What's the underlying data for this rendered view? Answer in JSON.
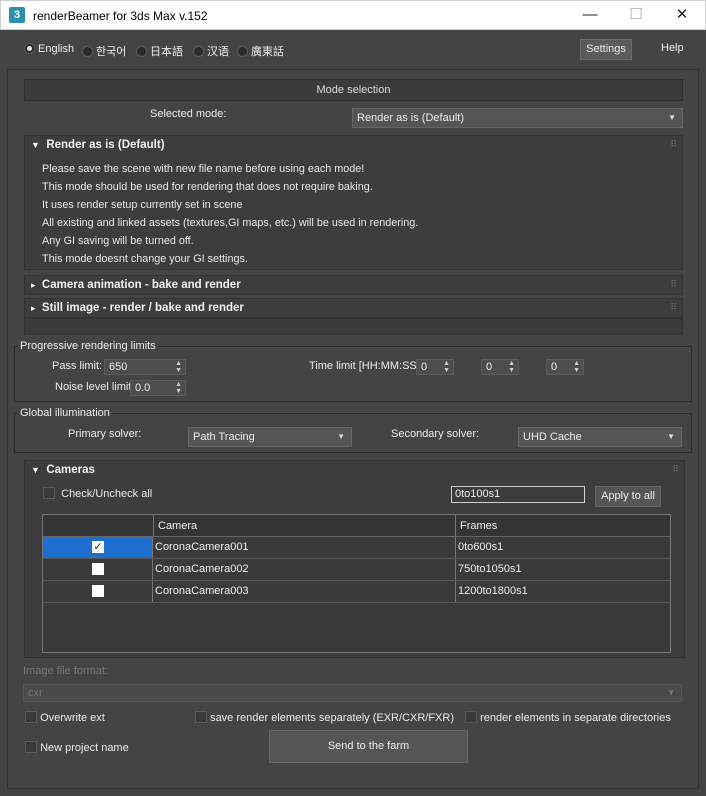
{
  "window": {
    "icon_text": "3",
    "title": "renderBeamer for 3ds Max v.152",
    "minimize": "—",
    "maximize": "☐",
    "close": "✕"
  },
  "languages": [
    {
      "label": "English",
      "selected": true
    },
    {
      "label": "한국어",
      "selected": false
    },
    {
      "label": "日本語",
      "selected": false
    },
    {
      "label": "汉语",
      "selected": false
    },
    {
      "label": "廣東話",
      "selected": false
    }
  ],
  "header": {
    "settings_label": "Settings",
    "help_label": "Help"
  },
  "mode": {
    "section_title": "Mode selection",
    "selected_label": "Selected mode:",
    "selected_value": "Render as is (Default)"
  },
  "rollouts": {
    "render_as_is": {
      "title": "Render as is (Default)",
      "lines": [
        "Please save the scene with new file name before using each mode!",
        "This mode should be used for rendering that does not require baking.",
        "It uses render setup currently set in scene",
        "All existing and linked assets (textures,GI maps, etc.) will be used in rendering.",
        "Any GI saving will be turned off.",
        "This mode doesnt change your GI settings."
      ]
    },
    "camera_animation": {
      "title": "Camera animation - bake and render"
    },
    "still_image": {
      "title": "Still image - render / bake and render"
    }
  },
  "progressive": {
    "group_title": "Progressive rendering limits",
    "pass_limit_label": "Pass limit:",
    "pass_limit_value": "650",
    "noise_limit_label": "Noise level limit",
    "noise_limit_value": "0.0",
    "time_limit_label": "Time limit [HH:MM:SS]",
    "hours": "0",
    "minutes": "0",
    "seconds": "0"
  },
  "gi": {
    "group_title": "Global illumination",
    "primary_label": "Primary solver:",
    "primary_value": "Path Tracing",
    "secondary_label": "Secondary solver:",
    "secondary_value": "UHD Cache"
  },
  "cameras": {
    "title": "Cameras",
    "check_all_label": "Check/Uncheck all",
    "frames_input": "0to100s1",
    "apply_label": "Apply to all",
    "columns": [
      "",
      "Camera",
      "Frames"
    ],
    "rows": [
      {
        "checked": true,
        "camera": "CoronaCamera001",
        "frames": "0to600s1",
        "selected": true
      },
      {
        "checked": false,
        "camera": "CoronaCamera002",
        "frames": "750to1050s1",
        "selected": false
      },
      {
        "checked": false,
        "camera": "CoronaCamera003",
        "frames": "1200to1800s1",
        "selected": false
      }
    ]
  },
  "output": {
    "format_label": "Image file format:",
    "format_value": "cxr",
    "overwrite_ext": "Overwrite ext",
    "save_elements": "save render elements separately (EXR/CXR/FXR)",
    "separate_dirs": "render elements in separate directories",
    "new_project": "New project name",
    "send_label": "Send to the farm"
  },
  "glyphs": {
    "check": "✓",
    "arrow_down": "▼",
    "arrow_right": "▸",
    "grip": "⠿",
    "spin_up": "▲",
    "spin_down": "▼"
  }
}
